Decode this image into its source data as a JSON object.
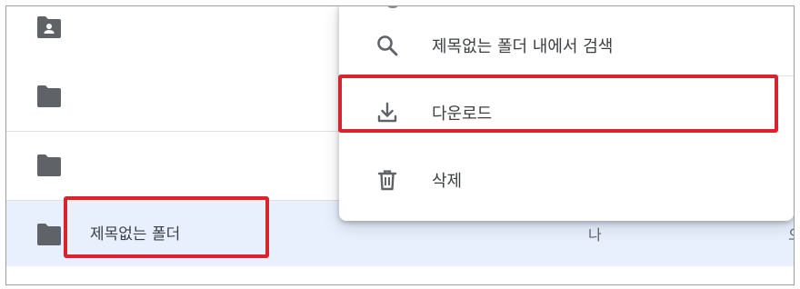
{
  "rows": [
    {
      "icon": "shared-folder-icon",
      "name": "",
      "owner": ""
    },
    {
      "icon": "folder-icon",
      "name": "",
      "owner": ""
    },
    {
      "icon": "folder-icon",
      "name": "",
      "owner": ""
    },
    {
      "icon": "folder-icon",
      "name": "제목없는 폴더",
      "owner": "나",
      "edge_text": "오",
      "selected": true
    }
  ],
  "context_menu": {
    "items": [
      {
        "icon": "search-icon",
        "label": "제목없는 폴더 내에서 검색"
      },
      {
        "icon": "download-icon",
        "label": "다운로드"
      },
      {
        "icon": "trash-icon",
        "label": "삭제"
      }
    ]
  },
  "colors": {
    "selected_row": "#e8f0fe",
    "highlight": "#d9232d",
    "icon": "#5f6368",
    "text": "#3c4043"
  }
}
